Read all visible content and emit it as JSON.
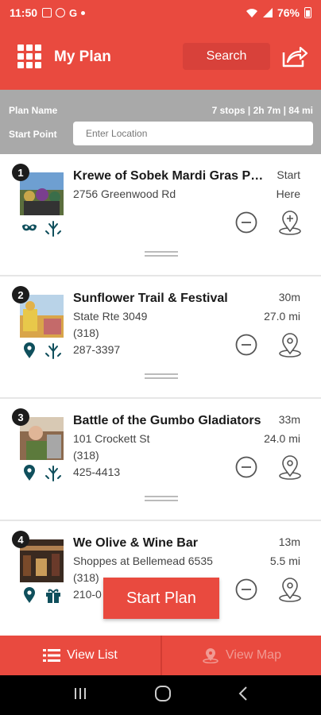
{
  "status_bar": {
    "time": "11:50",
    "battery": "76%"
  },
  "header": {
    "title": "My Plan",
    "search_label": "Search"
  },
  "plan": {
    "name_label": "Plan Name",
    "summary": "7 stops | 2h 7m | 84 mi",
    "start_label": "Start Point",
    "start_placeholder": "Enter Location"
  },
  "stops": [
    {
      "number": "1",
      "title": "Krewe of Sobek Mardi Gras Parade",
      "address": "2756 Greenwood Rd",
      "phone1": "",
      "phone2": "",
      "time": "Start",
      "distance": "Here",
      "icons": [
        "mask-icon",
        "fireworks-icon"
      ]
    },
    {
      "number": "2",
      "title": "Sunflower Trail & Festival",
      "address": "State Rte 3049",
      "phone1": "(318)",
      "phone2": "287-3397",
      "time": "30m",
      "distance": "27.0 mi",
      "icons": [
        "map-pin-icon",
        "fireworks-icon"
      ]
    },
    {
      "number": "3",
      "title": "Battle of the Gumbo Gladiators",
      "address": "101 Crockett St",
      "phone1": "(318)",
      "phone2": "425-4413",
      "time": "33m",
      "distance": "24.0 mi",
      "icons": [
        "map-pin-icon",
        "fireworks-icon"
      ]
    },
    {
      "number": "4",
      "title": "We Olive & Wine Bar",
      "address": "Shoppes at Bellemead 6535",
      "phone1": "(318)",
      "phone2": "210-0",
      "time": "13m",
      "distance": "5.5 mi",
      "icons": [
        "map-pin-icon",
        "gift-icon"
      ]
    }
  ],
  "start_plan_label": "Start Plan",
  "bottom_nav": {
    "list_label": "View List",
    "map_label": "View Map"
  },
  "colors": {
    "brand": "#e94a3f",
    "icon_teal": "#0f4f5c",
    "plan_bar": "#a9a9a9"
  }
}
